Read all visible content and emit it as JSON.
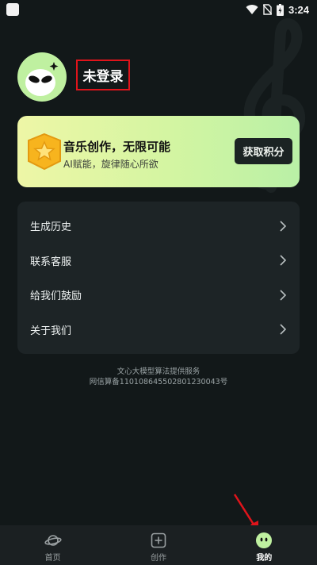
{
  "status_bar": {
    "time": "3:24"
  },
  "profile": {
    "login_label": "未登录"
  },
  "promo": {
    "title": "音乐创作，无限可能",
    "subtitle": "AI赋能，旋律随心所欲",
    "button_label": "获取积分"
  },
  "menu": {
    "items": [
      {
        "label": "生成历史"
      },
      {
        "label": "联系客服"
      },
      {
        "label": "给我们鼓励"
      },
      {
        "label": "关于我们"
      }
    ]
  },
  "footer": {
    "line1": "文心大模型算法提供服务",
    "line2": "网信算备110108645502801230043号"
  },
  "tabbar": {
    "tabs": [
      {
        "label": "首页",
        "icon": "planet-icon"
      },
      {
        "label": "创作",
        "icon": "plus-square-icon"
      },
      {
        "label": "我的",
        "icon": "face-icon",
        "active": true
      }
    ]
  },
  "colors": {
    "background": "#121819",
    "accent": "#bff0a0",
    "annotation": "#e0141b"
  }
}
